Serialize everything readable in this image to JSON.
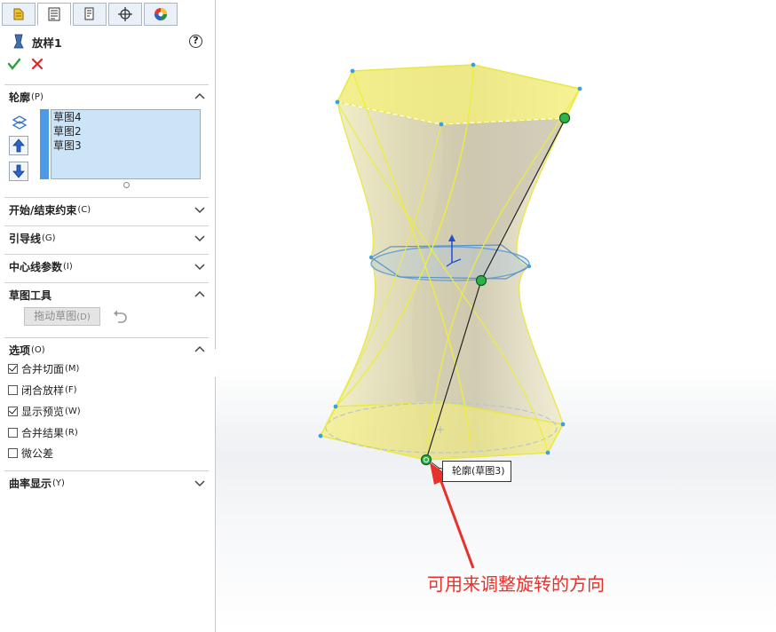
{
  "tabs": [
    {
      "icon": "feature-manager-icon",
      "active": false
    },
    {
      "icon": "property-manager-icon",
      "active": true
    },
    {
      "icon": "configuration-manager-icon",
      "active": false
    },
    {
      "icon": "dimxpert-icon",
      "active": false
    },
    {
      "icon": "display-manager-icon",
      "active": false
    }
  ],
  "feature": {
    "title": "放样1",
    "help": "?"
  },
  "sections": {
    "profile": {
      "label": "轮廓",
      "key": "(P)"
    },
    "start_end": {
      "label": "开始/结束约束",
      "key": "(C)"
    },
    "guide": {
      "label": "引导线",
      "key": "(G)"
    },
    "centerline": {
      "label": "中心线参数",
      "key": "(I)"
    },
    "sketch_tools": {
      "label": "草图工具",
      "key": ""
    },
    "options": {
      "label": "选项",
      "key": "(O)"
    },
    "curvature": {
      "label": "曲率显示",
      "key": "(Y)"
    }
  },
  "profiles": [
    "草图4",
    "草图2",
    "草图3"
  ],
  "sketch_tools": {
    "drag_label": "拖动草图",
    "drag_key": "(D)"
  },
  "options": [
    {
      "label": "合并切面",
      "key": "(M)",
      "checked": true
    },
    {
      "label": "闭合放样",
      "key": "(F)",
      "checked": false
    },
    {
      "label": "显示预览",
      "key": "(W)",
      "checked": true
    },
    {
      "label": "合并结果",
      "key": "(R)",
      "checked": false
    },
    {
      "label": "微公差",
      "key": "",
      "checked": false
    }
  ],
  "viewport": {
    "callout": "轮廓(草图3)",
    "annotation": "可用来调整旋转的方向",
    "accent_color": "#e8312a",
    "profile_color": "#ffff66",
    "handle_color": "#2db34a"
  }
}
